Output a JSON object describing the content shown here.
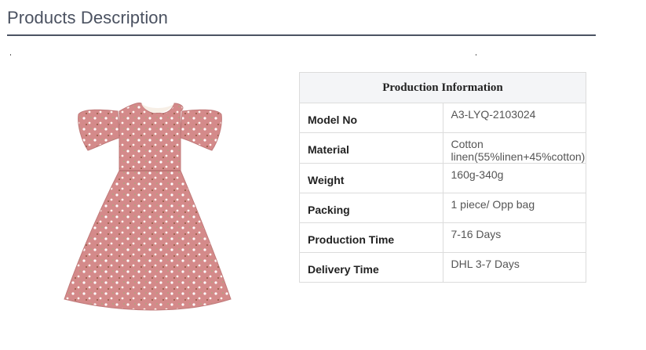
{
  "section": {
    "title": "Products Description"
  },
  "table": {
    "header": "Production Information",
    "rows": [
      {
        "label": "Model No",
        "value": "A3-LYQ-2103024"
      },
      {
        "label": "Material",
        "value": "Cotton linen(55%linen+45%cotton)"
      },
      {
        "label": "Weight",
        "value": "160g-340g"
      },
      {
        "label": "Packing",
        "value": "1 piece/ Opp bag"
      },
      {
        "label": "Production Time",
        "value": "7-16 Days"
      },
      {
        "label": "Delivery Time",
        "value": "DHL 3-7 Days"
      }
    ]
  },
  "image": {
    "subject": "pink floral flutter-sleeve baby dress",
    "color": "#d48a8a"
  }
}
